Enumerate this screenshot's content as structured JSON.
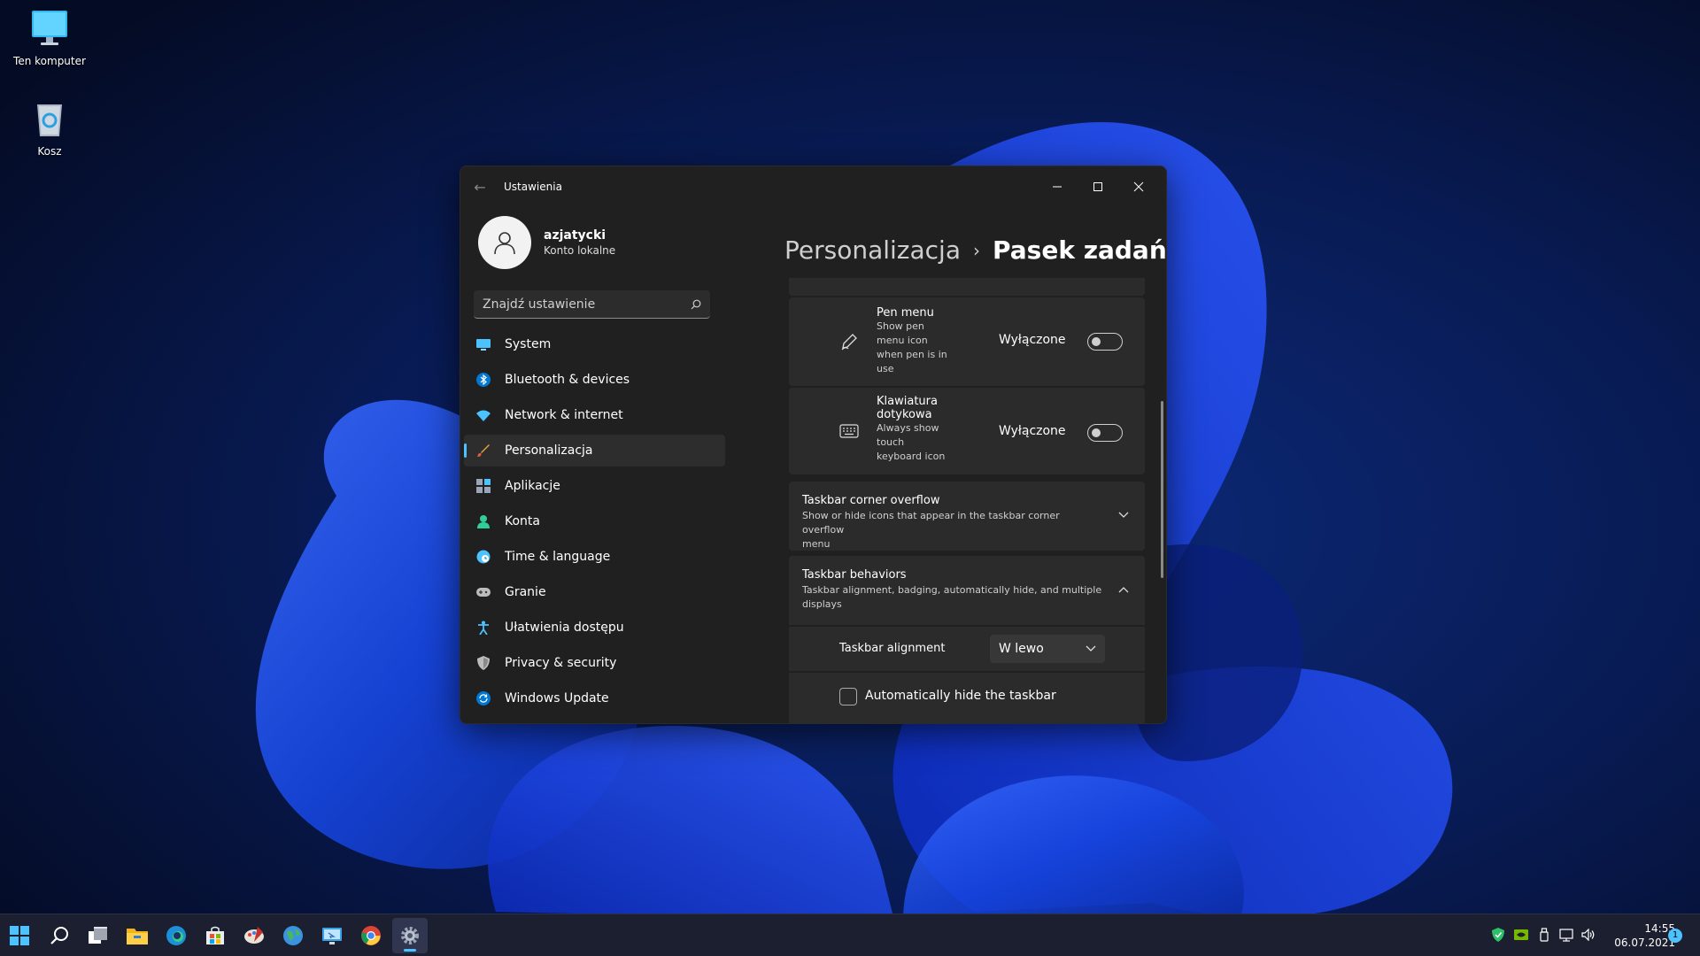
{
  "desktop": {
    "icons": [
      {
        "label": "Ten komputer",
        "icon": "monitor-icon"
      },
      {
        "label": "Kosz",
        "icon": "recycle-bin-icon"
      }
    ]
  },
  "window": {
    "title": "Ustawienia",
    "user": {
      "name": "azjatycki",
      "account": "Konto lokalne"
    },
    "search": {
      "placeholder": "Znajdź ustawienie"
    },
    "nav": [
      {
        "label": "System",
        "icon": "monitor-icon",
        "color": "#4cc2ff"
      },
      {
        "label": "Bluetooth & devices",
        "icon": "bluetooth-icon",
        "color": "#0078d4"
      },
      {
        "label": "Network & internet",
        "icon": "wifi-icon",
        "color": "#4cc2ff"
      },
      {
        "label": "Personalizacja",
        "icon": "brush-icon",
        "color": "#e8a23c",
        "active": true
      },
      {
        "label": "Aplikacje",
        "icon": "apps-icon",
        "color": "#9aa6b8"
      },
      {
        "label": "Konta",
        "icon": "person-icon",
        "color": "#2fcf9a"
      },
      {
        "label": "Time & language",
        "icon": "globe-clock-icon",
        "color": "#4cc2ff"
      },
      {
        "label": "Granie",
        "icon": "gamepad-icon",
        "color": "#bcbcbc"
      },
      {
        "label": "Ułatwienia dostępu",
        "icon": "accessibility-icon",
        "color": "#4cc2ff"
      },
      {
        "label": "Privacy & security",
        "icon": "shield-icon",
        "color": "#bcbcbc"
      },
      {
        "label": "Windows Update",
        "icon": "update-icon",
        "color": "#4cc2ff"
      }
    ],
    "breadcrumb": {
      "parent": "Personalizacja",
      "separator": "›",
      "current": "Pasek zadań"
    },
    "settings": {
      "pen_menu": {
        "title": "Pen menu",
        "subtitle_lines": [
          "Show pen",
          "menu icon",
          "when pen is in",
          "use"
        ],
        "state": "Wyłączone",
        "on": false
      },
      "touch_keyboard": {
        "title_lines": [
          "Klawiatura",
          "dotykowa"
        ],
        "subtitle_lines": [
          "Always show",
          "touch",
          "keyboard icon"
        ],
        "state": "Wyłączone",
        "on": false
      },
      "corner_overflow": {
        "title": "Taskbar corner overflow",
        "subtitle_lines": [
          "Show or hide icons that appear in the taskbar corner overflow",
          "menu"
        ]
      },
      "behaviors": {
        "title": "Taskbar behaviors",
        "subtitle_lines": [
          "Taskbar alignment, badging, automatically hide, and multiple",
          "displays"
        ],
        "alignment_label": "Taskbar alignment",
        "alignment_value": "W lewo",
        "autohide_label": "Automatically hide the taskbar",
        "autohide_checked": false
      }
    }
  },
  "taskbar": {
    "items": [
      {
        "name": "start-button",
        "icon": "windows-logo-icon"
      },
      {
        "name": "search-button",
        "icon": "search-icon"
      },
      {
        "name": "task-view-button",
        "icon": "task-view-icon"
      },
      {
        "name": "file-explorer-button",
        "icon": "folder-icon"
      },
      {
        "name": "edge-button",
        "icon": "edge-icon"
      },
      {
        "name": "store-button",
        "icon": "store-icon"
      },
      {
        "name": "paint-button",
        "icon": "paint-icon"
      },
      {
        "name": "globe-app-button",
        "icon": "globe-icon"
      },
      {
        "name": "remote-desktop-button",
        "icon": "remote-desktop-icon"
      },
      {
        "name": "chrome-button",
        "icon": "chrome-icon"
      },
      {
        "name": "settings-button",
        "icon": "gear-icon",
        "active": true
      }
    ],
    "clock": {
      "time": "14:55",
      "date": "06.07.2021"
    },
    "notifications": "1"
  }
}
